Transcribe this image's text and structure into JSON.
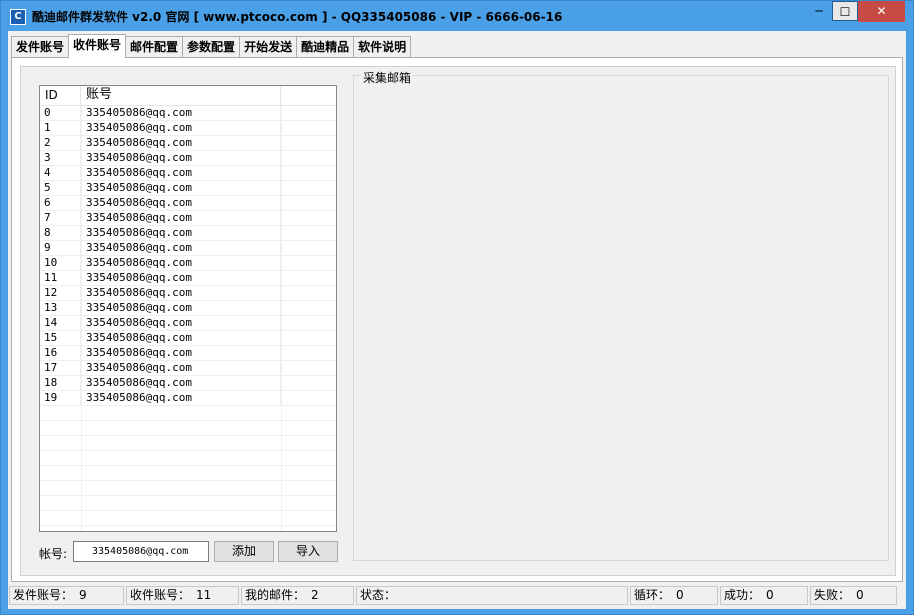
{
  "window": {
    "title": "酷迪邮件群发软件 v2.0 官网 [ www.ptcoco.com ] - QQ335405086 - VIP - 6666-06-16",
    "icon_letter": "C",
    "minimize_glyph": "─",
    "maximize_glyph": "☐",
    "close_glyph": "✕"
  },
  "tabs": [
    {
      "label": "发件账号",
      "active": false
    },
    {
      "label": "收件账号",
      "active": true
    },
    {
      "label": "邮件配置",
      "active": false
    },
    {
      "label": "参数配置",
      "active": false
    },
    {
      "label": "开始发送",
      "active": false
    },
    {
      "label": "酷迪精品",
      "active": false
    },
    {
      "label": "软件说明",
      "active": false
    }
  ],
  "listview": {
    "headers": {
      "id": "ID",
      "account": "账号"
    },
    "rows": [
      {
        "id": "0",
        "account": "335405086@qq.com"
      },
      {
        "id": "1",
        "account": "335405086@qq.com"
      },
      {
        "id": "2",
        "account": "335405086@qq.com"
      },
      {
        "id": "3",
        "account": "335405086@qq.com"
      },
      {
        "id": "4",
        "account": "335405086@qq.com"
      },
      {
        "id": "5",
        "account": "335405086@qq.com"
      },
      {
        "id": "6",
        "account": "335405086@qq.com"
      },
      {
        "id": "7",
        "account": "335405086@qq.com"
      },
      {
        "id": "8",
        "account": "335405086@qq.com"
      },
      {
        "id": "9",
        "account": "335405086@qq.com"
      },
      {
        "id": "10",
        "account": "335405086@qq.com"
      },
      {
        "id": "11",
        "account": "335405086@qq.com"
      },
      {
        "id": "12",
        "account": "335405086@qq.com"
      },
      {
        "id": "13",
        "account": "335405086@qq.com"
      },
      {
        "id": "14",
        "account": "335405086@qq.com"
      },
      {
        "id": "15",
        "account": "335405086@qq.com"
      },
      {
        "id": "16",
        "account": "335405086@qq.com"
      },
      {
        "id": "17",
        "account": "335405086@qq.com"
      },
      {
        "id": "18",
        "account": "335405086@qq.com"
      },
      {
        "id": "19",
        "account": "335405086@qq.com"
      }
    ]
  },
  "form": {
    "account_label": "帐号:",
    "account_value": "335405086@qq.com",
    "add_button": "添加",
    "import_button": "导入"
  },
  "collect_group": {
    "title": "采集邮箱"
  },
  "status": {
    "send_accounts_label": "发件账号：",
    "send_accounts_value": "9",
    "recv_accounts_label": "收件账号：",
    "recv_accounts_value": "11",
    "my_mails_label": "我的邮件：",
    "my_mails_value": "2",
    "state_label": "状态：",
    "state_value": "",
    "loop_label": "循环：",
    "loop_value": "0",
    "success_label": "成功：",
    "success_value": "0",
    "fail_label": "失败：",
    "fail_value": "0"
  },
  "colors": {
    "titlebar": "#4aa0e6",
    "close_button": "#c74b45"
  }
}
